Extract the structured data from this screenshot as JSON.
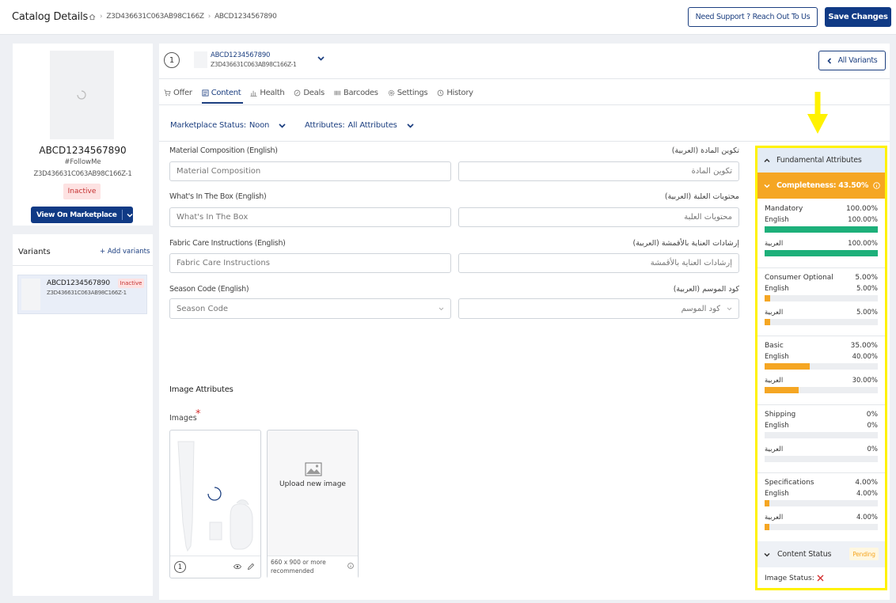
{
  "header": {
    "title": "Catalog Details",
    "crumb1": "Z3D436631C063AB98C166Z",
    "crumb2": "ABCD1234567890",
    "support_label": "Need Support ? Reach Out To Us",
    "save_label": "Save Changes"
  },
  "product": {
    "sku": "ABCD1234567890",
    "tag": "#FollowMe",
    "id": "Z3D436631C063AB98C166Z-1",
    "status": "Inactive",
    "view_label": "View On Marketplace"
  },
  "variants": {
    "title": "Variants",
    "add_label": "+ Add variants",
    "items": [
      {
        "sku": "ABCD1234567890",
        "id": "Z3D436631C063AB98C166Z-1",
        "status": "Inactive"
      }
    ]
  },
  "variant_header": {
    "number": "1",
    "sku": "ABCD1234567890",
    "id": "Z3D436631C063AB98C166Z-1",
    "all_variants_label": "All Variants"
  },
  "tabs": [
    {
      "label": "Offer",
      "icon": "cart-icon"
    },
    {
      "label": "Content",
      "icon": "document-icon"
    },
    {
      "label": "Health",
      "icon": "chart-icon"
    },
    {
      "label": "Deals",
      "icon": "tag-icon"
    },
    {
      "label": "Barcodes",
      "icon": "barcode-icon"
    },
    {
      "label": "Settings",
      "icon": "gear-icon"
    },
    {
      "label": "History",
      "icon": "history-icon"
    }
  ],
  "filters": {
    "marketplace_label": "Marketplace Status:",
    "marketplace_value": "Noon",
    "attributes_label": "Attributes:",
    "attributes_value": "All Attributes"
  },
  "form": {
    "material_en_label": "Material Composition (English)",
    "material_ar_label": "تكوين المادة (العربية)",
    "material_en_placeholder": "Material Composition",
    "material_ar_placeholder": "تكوين المادة",
    "box_en_label": "What's In The Box (English)",
    "box_ar_label": "محتويات العلبة (العربية)",
    "box_en_placeholder": "What's In The Box",
    "box_ar_placeholder": "محتويات العلبة",
    "fabric_en_label": "Fabric Care Instructions (English)",
    "fabric_ar_label": "إرشادات العناية بالأقمشة (العربية)",
    "fabric_en_placeholder": "Fabric Care Instructions",
    "fabric_ar_placeholder": "إرشادات العناية بالأقمشة",
    "season_en_label": "Season Code (English)",
    "season_ar_label": "كود الموسم (العربية)",
    "season_en_placeholder": "Season Code",
    "season_ar_placeholder": "كود الموسم"
  },
  "images": {
    "section_title": "Image Attributes",
    "label": "Images",
    "required_mark": "*",
    "image_number": "1",
    "upload_label": "Upload new image",
    "recommend_line1": "660 x 900 or more",
    "recommend_line2": "recommended"
  },
  "fundamental": {
    "title": "Fundamental Attributes",
    "completeness_label": "Completeness: 43.50%",
    "categories": [
      {
        "name": "Mandatory",
        "total": "100.00%",
        "english": "100.00%",
        "arabic": "100.00%",
        "english_pct": 100,
        "arabic_pct": 100,
        "color": "#1db07a"
      },
      {
        "name": "Consumer Optional",
        "total": "5.00%",
        "english": "5.00%",
        "arabic": "5.00%",
        "english_pct": 5,
        "arabic_pct": 5,
        "color": "#f5a623"
      },
      {
        "name": "Basic",
        "total": "35.00%",
        "english": "40.00%",
        "arabic": "30.00%",
        "english_pct": 40,
        "arabic_pct": 30,
        "color": "#f5a623"
      },
      {
        "name": "Shipping",
        "total": "0%",
        "english": "0%",
        "arabic": "0%",
        "english_pct": 0,
        "arabic_pct": 0,
        "color": "#f5a623"
      },
      {
        "name": "Specifications",
        "total": "4.00%",
        "english": "4.00%",
        "arabic": "4.00%",
        "english_pct": 4,
        "arabic_pct": 4,
        "color": "#f5a623"
      }
    ],
    "english_label": "English",
    "arabic_label": "العربية"
  },
  "content_status": {
    "title": "Content Status",
    "badge": "Pending",
    "image_status_label": "Image Status:"
  },
  "colors": {
    "primary": "#103a85",
    "highlight": "#fff200",
    "completeness": "#f5a623",
    "success": "#1db07a"
  }
}
